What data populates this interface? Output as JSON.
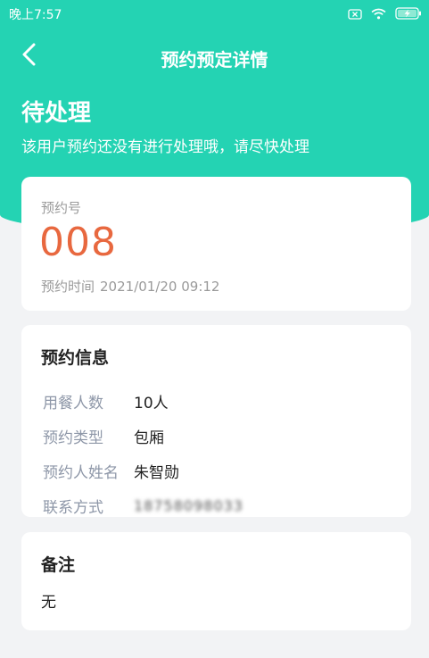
{
  "status_bar": {
    "time": "晚上7:57",
    "icons": [
      "close-box-icon",
      "wifi-icon",
      "battery-charging-icon"
    ]
  },
  "nav": {
    "back_icon": "chevron-left-icon",
    "title": "预约预定详情"
  },
  "status": {
    "heading": "待处理",
    "description": "该用户预约还没有进行处理哦，请尽快处理"
  },
  "reservation": {
    "number_label": "预约号",
    "number": "008",
    "time_label": "预约时间",
    "time_value": "2021/01/20 09:12"
  },
  "info": {
    "title": "预约信息",
    "rows": [
      {
        "label": "用餐人数",
        "value": "10人"
      },
      {
        "label": "预约类型",
        "value": "包厢"
      },
      {
        "label": "预约人姓名",
        "value": "朱智勋"
      },
      {
        "label": "联系方式",
        "value": "18758098033"
      }
    ]
  },
  "note": {
    "title": "备注",
    "text": "无"
  },
  "colors": {
    "brand": "#24d3b3",
    "number": "#e8683f",
    "background": "#f2f3f5"
  }
}
